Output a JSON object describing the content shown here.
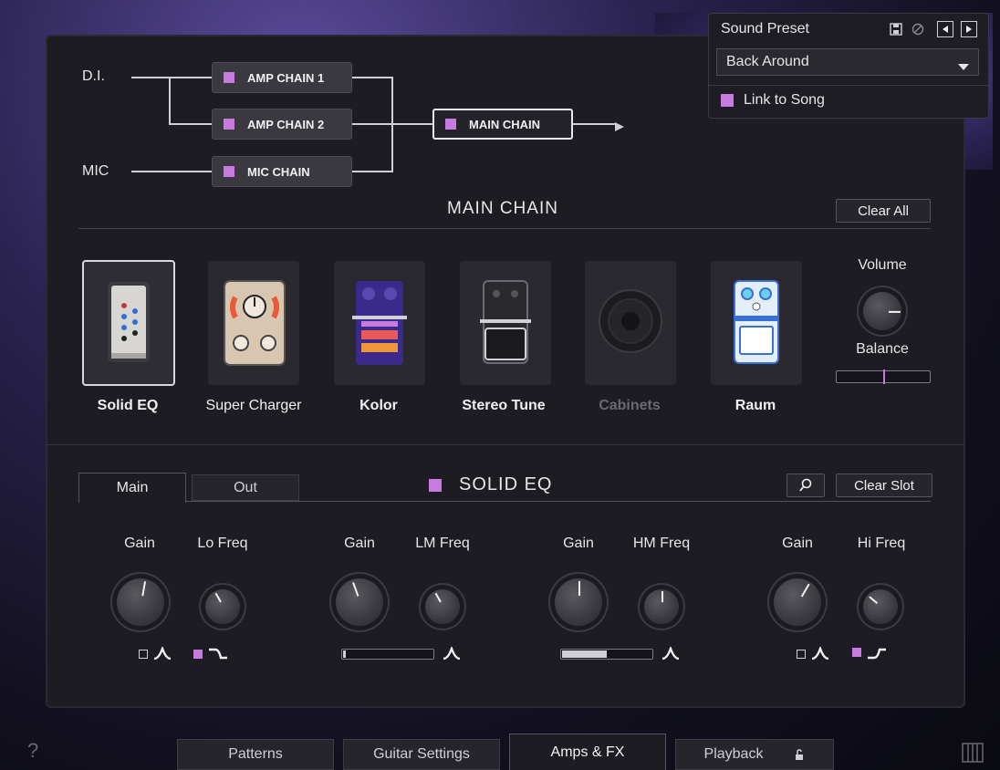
{
  "preset": {
    "title": "Sound Preset",
    "selected": "Back Around",
    "link_label": "Link to Song"
  },
  "routing": {
    "inputs": [
      "D.I.",
      "MIC"
    ],
    "chains": [
      "AMP CHAIN 1",
      "AMP CHAIN 2",
      "MIC CHAIN"
    ],
    "output": "MAIN CHAIN"
  },
  "main_chain": {
    "title": "MAIN CHAIN",
    "clear_all": "Clear All",
    "slots": [
      {
        "name": "Solid EQ",
        "active": true,
        "enabled": true
      },
      {
        "name": "Super Charger",
        "active": false,
        "enabled": true
      },
      {
        "name": "Kolor",
        "active": false,
        "enabled": true
      },
      {
        "name": "Stereo Tune",
        "active": false,
        "enabled": true
      },
      {
        "name": "Cabinets",
        "active": false,
        "enabled": false
      },
      {
        "name": "Raum",
        "active": false,
        "enabled": true
      }
    ],
    "volume_label": "Volume",
    "balance_label": "Balance",
    "balance_value": 0.5
  },
  "editor": {
    "tabs": [
      "Main",
      "Out"
    ],
    "active_tab": "Main",
    "title": "SOLID EQ",
    "clear_slot": "Clear Slot",
    "bands": [
      {
        "gain_label": "Gain",
        "freq_label": "Lo Freq"
      },
      {
        "gain_label": "Gain",
        "freq_label": "LM Freq",
        "q_value": 0.03
      },
      {
        "gain_label": "Gain",
        "freq_label": "HM Freq",
        "q_value": 0.5
      },
      {
        "gain_label": "Gain",
        "freq_label": "Hi Freq"
      }
    ]
  },
  "bottom_tabs": [
    "Patterns",
    "Guitar Settings",
    "Amps & FX",
    "Playback"
  ],
  "active_bottom_tab": "Amps & FX",
  "help": "?",
  "colors": {
    "accent": "#c77be0",
    "panel": "#1d1c22"
  }
}
